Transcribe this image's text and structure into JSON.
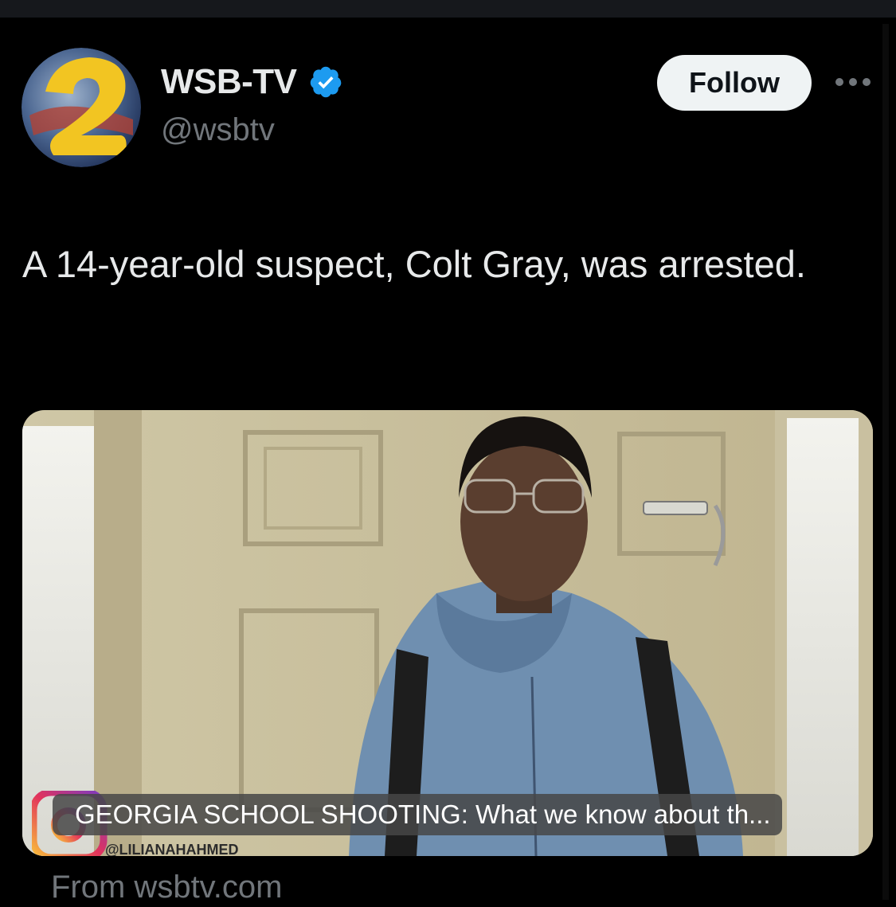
{
  "post": {
    "author_name": "WSB-TV",
    "author_handle": "@wsbtv",
    "verified_icon": "verified-badge-icon",
    "follow_label": "Follow",
    "more_icon": "more-options-icon",
    "text": "A 14-year-old suspect, Colt Gray, was arrested.",
    "card": {
      "title": "GEORGIA SCHOOL SHOOTING: What we know about th...",
      "watermark": "@LILIANAHAHMED",
      "source": "From wsbtv.com"
    }
  },
  "colors": {
    "background": "#000000",
    "follow_bg": "#eff3f4",
    "verified": "#1d9bf0",
    "secondary_text": "#71767b"
  }
}
